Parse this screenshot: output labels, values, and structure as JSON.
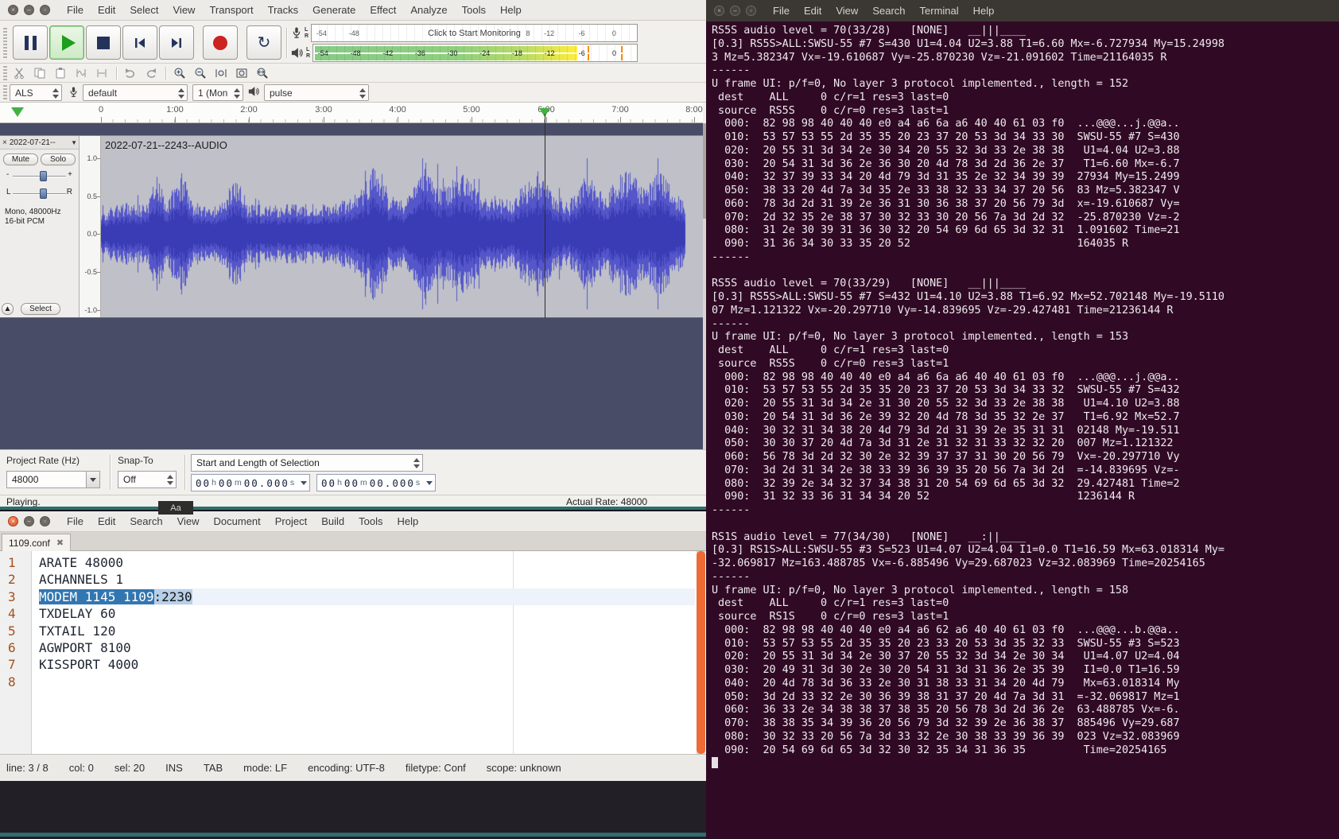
{
  "artifact": {
    "label": "Aa"
  },
  "audacity": {
    "menu": [
      "File",
      "Edit",
      "Select",
      "View",
      "Transport",
      "Tracks",
      "Generate",
      "Effect",
      "Analyze",
      "Tools",
      "Help"
    ],
    "meters": {
      "rec": {
        "l": "L",
        "r": "R",
        "monitor": "Click to Start Monitoring",
        "ticks": [
          "-54",
          "-48",
          "8",
          "-12",
          "-6",
          "0"
        ]
      },
      "play": {
        "l": "L",
        "r": "R",
        "ticks": [
          "-54",
          "-48",
          "-42",
          "-36",
          "-30",
          "-24",
          "-18",
          "-12",
          "-6",
          "0"
        ]
      }
    },
    "device": {
      "host": "ALS",
      "rec_dev": "default",
      "channels": "1 (Mon",
      "play_dev": "pulse"
    },
    "timeline": [
      "0",
      "1:00",
      "2:00",
      "3:00",
      "4:00",
      "5:00",
      "6:00",
      "7:00",
      "8:00"
    ],
    "track": {
      "tab": "2022-07-21--",
      "name": "2022-07-21--2243--AUDIO",
      "mute": "Mute",
      "solo": "Solo",
      "gain_min": "-",
      "gain_max": "+",
      "pan_l": "L",
      "pan_r": "R",
      "fmt1": "Mono, 48000Hz",
      "fmt2": "16-bit PCM",
      "select": "Select",
      "vruler": [
        "1.0",
        "0.5",
        "0.0",
        "-0.5",
        "-1.0"
      ]
    },
    "selbar": {
      "rate_label": "Project Rate (Hz)",
      "rate": "48000",
      "snap_label": "Snap-To",
      "snap": "Off",
      "mode": "Start and Length of Selection",
      "time1": "00h00m00.000s",
      "time2": "00h00m00.000s"
    },
    "status_left": "Playing.",
    "status_right": "Actual Rate: 48000"
  },
  "editor": {
    "menu": [
      "File",
      "Edit",
      "Search",
      "View",
      "Document",
      "Project",
      "Build",
      "Tools",
      "Help"
    ],
    "tab": "1109.conf",
    "lines": [
      "ARATE 48000",
      "ACHANNELS 1",
      {
        "sel": "MODEM 1145 1109",
        "rest": ":2230"
      },
      "TXDELAY 60",
      "TXTAIL 120",
      "AGWPORT 8100",
      "KISSPORT 4000",
      ""
    ],
    "status": [
      "line: 3 / 8",
      "col: 0",
      "sel: 20",
      "INS",
      "TAB",
      "mode: LF",
      "encoding: UTF-8",
      "filetype: Conf",
      "scope: unknown"
    ]
  },
  "terminal": {
    "menu": [
      "File",
      "Edit",
      "View",
      "Search",
      "Terminal",
      "Help"
    ],
    "lines": [
      "RS5S audio level = 70(33/28)   [NONE]   __|||____",
      "[0.3] RS5S>ALL:SWSU-55 #7 S=430 U1=4.04 U2=3.88 T1=6.60 Mx=-6.727934 My=15.24998",
      "3 Mz=5.382347 Vx=-19.610687 Vy=-25.870230 Vz=-21.091602 Time=21164035 R",
      "------",
      "U frame UI: p/f=0, No layer 3 protocol implemented., length = 152",
      " dest    ALL     0 c/r=1 res=3 last=0",
      " source  RS5S    0 c/r=0 res=3 last=1",
      "  000:  82 98 98 40 40 40 e0 a4 a6 6a a6 40 40 61 03 f0  ...@@@...j.@@a..",
      "  010:  53 57 53 55 2d 35 35 20 23 37 20 53 3d 34 33 30  SWSU-55 #7 S=430",
      "  020:  20 55 31 3d 34 2e 30 34 20 55 32 3d 33 2e 38 38   U1=4.04 U2=3.88",
      "  030:  20 54 31 3d 36 2e 36 30 20 4d 78 3d 2d 36 2e 37   T1=6.60 Mx=-6.7",
      "  040:  32 37 39 33 34 20 4d 79 3d 31 35 2e 32 34 39 39  27934 My=15.2499",
      "  050:  38 33 20 4d 7a 3d 35 2e 33 38 32 33 34 37 20 56  83 Mz=5.382347 V",
      "  060:  78 3d 2d 31 39 2e 36 31 30 36 38 37 20 56 79 3d  x=-19.610687 Vy=",
      "  070:  2d 32 35 2e 38 37 30 32 33 30 20 56 7a 3d 2d 32  -25.870230 Vz=-2",
      "  080:  31 2e 30 39 31 36 30 32 20 54 69 6d 65 3d 32 31  1.091602 Time=21",
      "  090:  31 36 34 30 33 35 20 52                          164035 R",
      "------",
      "",
      "RS5S audio level = 70(33/29)   [NONE]   __|||____",
      "[0.3] RS5S>ALL:SWSU-55 #7 S=432 U1=4.10 U2=3.88 T1=6.92 Mx=52.702148 My=-19.5110",
      "07 Mz=1.121322 Vx=-20.297710 Vy=-14.839695 Vz=-29.427481 Time=21236144 R",
      "------",
      "U frame UI: p/f=0, No layer 3 protocol implemented., length = 153",
      " dest    ALL     0 c/r=1 res=3 last=0",
      " source  RS5S    0 c/r=0 res=3 last=1",
      "  000:  82 98 98 40 40 40 e0 a4 a6 6a a6 40 40 61 03 f0  ...@@@...j.@@a..",
      "  010:  53 57 53 55 2d 35 35 20 23 37 20 53 3d 34 33 32  SWSU-55 #7 S=432",
      "  020:  20 55 31 3d 34 2e 31 30 20 55 32 3d 33 2e 38 38   U1=4.10 U2=3.88",
      "  030:  20 54 31 3d 36 2e 39 32 20 4d 78 3d 35 32 2e 37   T1=6.92 Mx=52.7",
      "  040:  30 32 31 34 38 20 4d 79 3d 2d 31 39 2e 35 31 31  02148 My=-19.511",
      "  050:  30 30 37 20 4d 7a 3d 31 2e 31 32 31 33 32 32 20  007 Mz=1.121322 ",
      "  060:  56 78 3d 2d 32 30 2e 32 39 37 37 31 30 20 56 79  Vx=-20.297710 Vy",
      "  070:  3d 2d 31 34 2e 38 33 39 36 39 35 20 56 7a 3d 2d  =-14.839695 Vz=-",
      "  080:  32 39 2e 34 32 37 34 38 31 20 54 69 6d 65 3d 32  29.427481 Time=2",
      "  090:  31 32 33 36 31 34 34 20 52                       1236144 R",
      "------",
      "",
      "RS1S audio level = 77(34/30)   [NONE]   __:||____",
      "[0.3] RS1S>ALL:SWSU-55 #3 S=523 U1=4.07 U2=4.04 I1=0.0 T1=16.59 Mx=63.018314 My=",
      "-32.069817 Mz=163.488785 Vx=-6.885496 Vy=29.687023 Vz=32.083969 Time=20254165",
      "------",
      "U frame UI: p/f=0, No layer 3 protocol implemented., length = 158",
      " dest    ALL     0 c/r=1 res=3 last=0",
      " source  RS1S    0 c/r=0 res=3 last=1",
      "  000:  82 98 98 40 40 40 e0 a4 a6 62 a6 40 40 61 03 f0  ...@@@...b.@@a..",
      "  010:  53 57 53 55 2d 35 35 20 23 33 20 53 3d 35 32 33  SWSU-55 #3 S=523",
      "  020:  20 55 31 3d 34 2e 30 37 20 55 32 3d 34 2e 30 34   U1=4.07 U2=4.04",
      "  030:  20 49 31 3d 30 2e 30 20 54 31 3d 31 36 2e 35 39   I1=0.0 T1=16.59",
      "  040:  20 4d 78 3d 36 33 2e 30 31 38 33 31 34 20 4d 79   Mx=63.018314 My",
      "  050:  3d 2d 33 32 2e 30 36 39 38 31 37 20 4d 7a 3d 31  =-32.069817 Mz=1",
      "  060:  36 33 2e 34 38 38 37 38 35 20 56 78 3d 2d 36 2e  63.488785 Vx=-6.",
      "  070:  38 38 35 34 39 36 20 56 79 3d 32 39 2e 36 38 37  885496 Vy=29.687",
      "  080:  30 32 33 20 56 7a 3d 33 32 2e 30 38 33 39 36 39  023 Vz=32.083969",
      "  090:  20 54 69 6d 65 3d 32 30 32 35 34 31 36 35         Time=20254165"
    ]
  }
}
